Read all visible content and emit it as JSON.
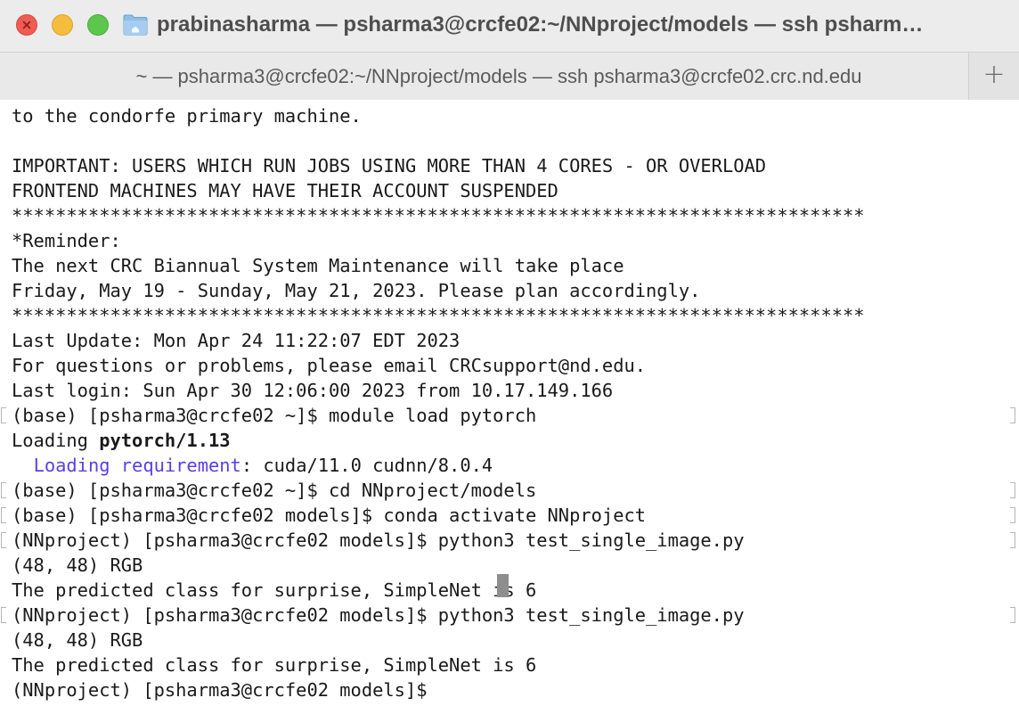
{
  "window": {
    "title": "prabinasharma — psharma3@crcfe02:~/NNproject/models — ssh psharm…",
    "tab_label": "~ — psharma3@crcfe02:~/NNproject/models — ssh psharma3@crcfe02.crc.nd.edu",
    "new_tab_symbol": "+",
    "icons": [
      "close-icon",
      "minimize-icon",
      "zoom-icon",
      "folder-icon",
      "plus-icon"
    ]
  },
  "colors": {
    "close": "#ee5c53",
    "minimize": "#f5bd3c",
    "zoom": "#5dc74d",
    "prompt_highlight": "#5b3ee6"
  },
  "terminal": {
    "lines": [
      "to the condorfe primary machine.",
      "",
      "IMPORTANT: USERS WHICH RUN JOBS USING MORE THAN 4 CORES - OR OVERLOAD",
      "FRONTEND MACHINES MAY HAVE THEIR ACCOUNT SUSPENDED",
      "******************************************************************************",
      "*Reminder:",
      "The next CRC Biannual System Maintenance will take place",
      "Friday, May 19 - Sunday, May 21, 2023. Please plan accordingly.",
      "******************************************************************************",
      "Last Update: Mon Apr 24 11:22:07 EDT 2023",
      "For questions or problems, please email CRCsupport@nd.edu.",
      "Last login: Sun Apr 30 12:06:00 2023 from 10.17.149.166",
      "(base) [psharma3@crcfe02 ~]$ module load pytorch",
      "",
      "",
      "(base) [psharma3@crcfe02 ~]$ cd NNproject/models",
      "(base) [psharma3@crcfe02 models]$ conda activate NNproject",
      "(NNproject) [psharma3@crcfe02 models]$ python3 test_single_image.py",
      "(48, 48) RGB",
      "The predicted class for surprise, SimpleNet is 6",
      "(NNproject) [psharma3@crcfe02 models]$ python3 test_single_image.py",
      "(48, 48) RGB",
      "The predicted class for surprise, SimpleNet is 6",
      "(NNproject) [psharma3@crcfe02 models]$ "
    ],
    "loading_prefix": "Loading ",
    "loading_module": "pytorch/1.13",
    "requirement_indent": "  ",
    "requirement_label": "Loading requirement",
    "requirement_value": ": cuda/11.0 cudnn/8.0.4"
  }
}
